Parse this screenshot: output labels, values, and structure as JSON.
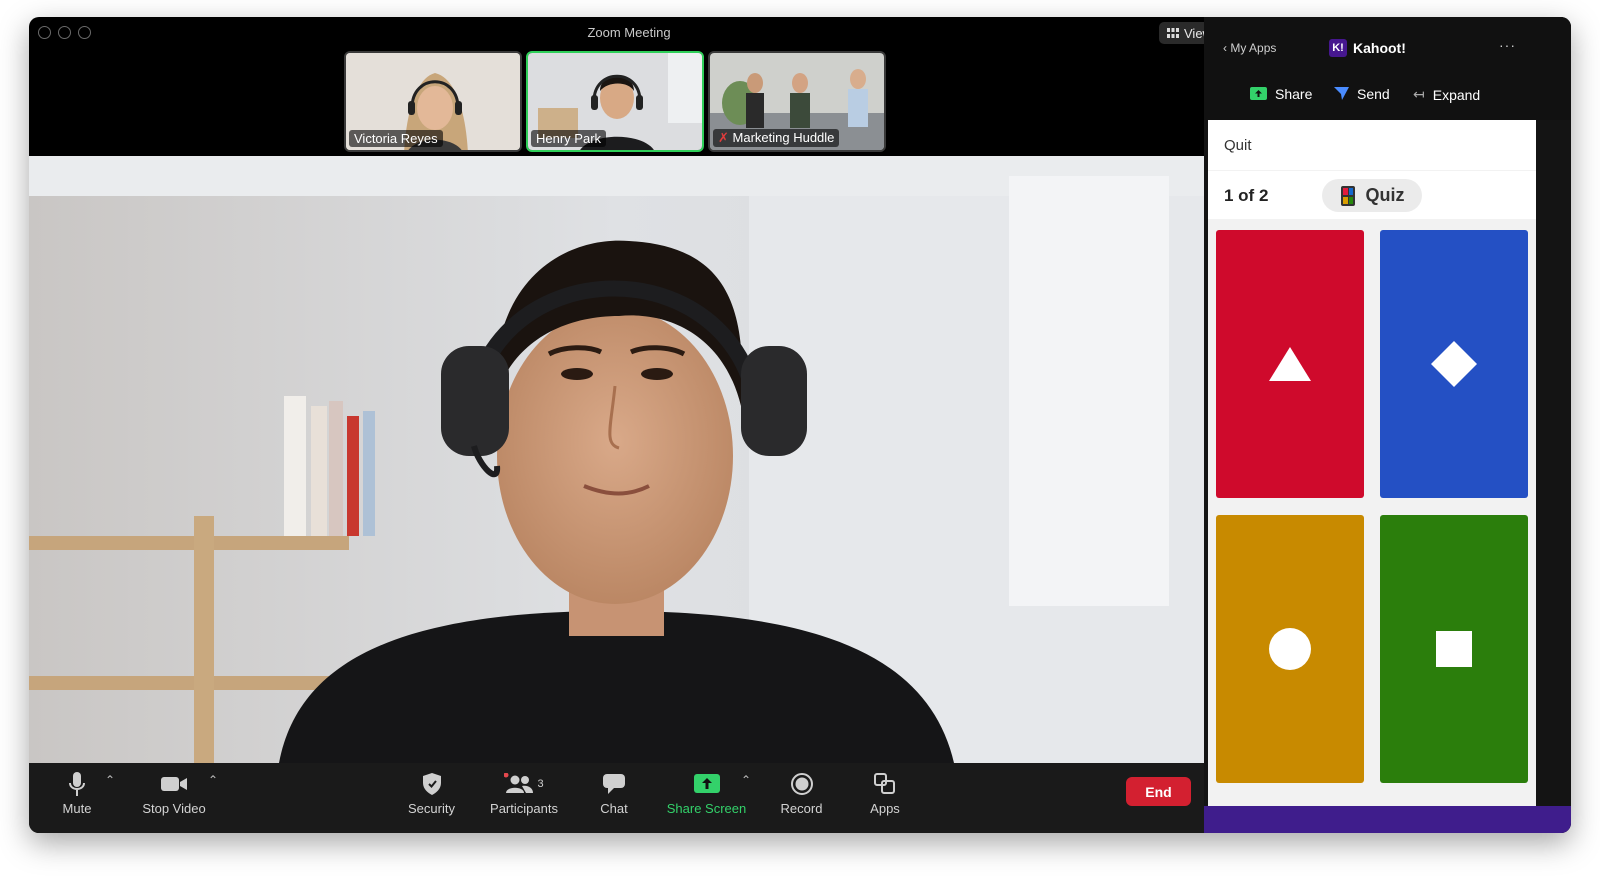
{
  "window": {
    "title": "Zoom Meeting",
    "view_label": "View"
  },
  "participants_strip": [
    {
      "name": "Victoria Reyes"
    },
    {
      "name": "Henry Park"
    },
    {
      "name": "Marketing Huddle"
    }
  ],
  "toolbar": {
    "mute": "Mute",
    "stop_video": "Stop Video",
    "security": "Security",
    "participants": "Participants",
    "participants_count": "3",
    "chat": "Chat",
    "share_screen": "Share Screen",
    "record": "Record",
    "apps": "Apps",
    "end": "End"
  },
  "panel": {
    "back_label": "My Apps",
    "app_name": "Kahoot!",
    "logo_text": "K!",
    "actions": {
      "share": "Share",
      "send": "Send",
      "expand": "Expand"
    },
    "quit": "Quit",
    "progress": "1 of 2",
    "mode": "Quiz",
    "answers": [
      {
        "shape": "triangle",
        "color": "#cf0a2c"
      },
      {
        "shape": "diamond",
        "color": "#2450c4"
      },
      {
        "shape": "circle",
        "color": "#c88a00"
      },
      {
        "shape": "square",
        "color": "#2b7e0c"
      }
    ]
  },
  "colors": {
    "accent_green": "#33d16a",
    "end_red": "#d32030",
    "kahoot_purple": "#46178f"
  }
}
